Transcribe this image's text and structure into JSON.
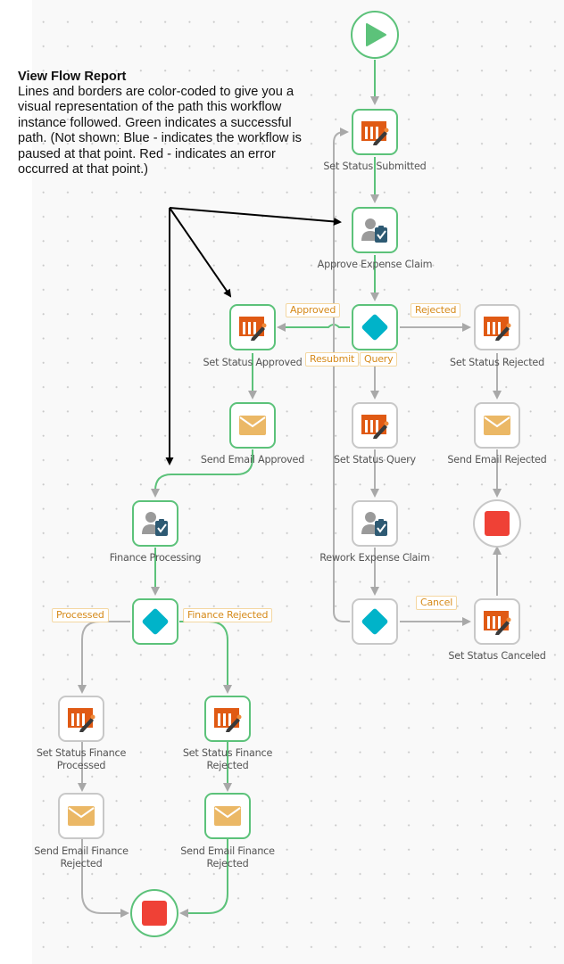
{
  "annotation": {
    "title": "View Flow Report",
    "body": "Lines and borders are color-coded to give you a visual representation of the path this workflow instance followed. Green indicates a successful path. (Not shown: Blue - indicates the workflow is paused at that point. Red - indicates an error occurred at that point.)"
  },
  "colors": {
    "success": "#5cc27a",
    "not_taken": "#c8c8c8",
    "decision": "#00b3c9",
    "stop": "#ef4136",
    "status_icon": "#e05a14",
    "email_icon": "#ebb866",
    "task_icon_badge": "#2e5a73",
    "branch_label": "#d68a1a"
  },
  "nodes": {
    "start": {
      "label": "",
      "type": "start",
      "status": "success"
    },
    "set_status_submitted": {
      "label": "Set Status Submitted",
      "type": "set-status",
      "status": "success"
    },
    "approve_expense_claim": {
      "label": "Approve Expense Claim",
      "type": "task",
      "status": "success"
    },
    "decision_approve": {
      "label": "",
      "type": "decision",
      "status": "success"
    },
    "set_status_approved": {
      "label": "Set Status Approved",
      "type": "set-status",
      "status": "success"
    },
    "send_email_approved": {
      "label": "Send Email Approved",
      "type": "email",
      "status": "success"
    },
    "set_status_rejected": {
      "label": "Set Status Rejected",
      "type": "set-status",
      "status": "not-taken"
    },
    "send_email_rejected": {
      "label": "Send Email Rejected",
      "type": "email",
      "status": "not-taken"
    },
    "stop_rejected": {
      "label": "",
      "type": "stop",
      "status": "not-taken"
    },
    "set_status_query": {
      "label": "Set Status Query",
      "type": "set-status",
      "status": "not-taken"
    },
    "rework_expense_claim": {
      "label": "Rework Expense Claim",
      "type": "task",
      "status": "not-taken"
    },
    "decision_rework": {
      "label": "",
      "type": "decision",
      "status": "not-taken"
    },
    "set_status_canceled": {
      "label": "Set Status Canceled",
      "type": "set-status",
      "status": "not-taken"
    },
    "finance_processing": {
      "label": "Finance Processing",
      "type": "task",
      "status": "success"
    },
    "decision_finance": {
      "label": "",
      "type": "decision",
      "status": "success"
    },
    "set_status_finance_processed": {
      "label": "Set Status Finance Processed",
      "type": "set-status",
      "status": "not-taken"
    },
    "set_status_finance_rejected": {
      "label": "Set Status Finance Rejected",
      "type": "set-status",
      "status": "success"
    },
    "send_email_finance_rejected_left": {
      "label": "Send Email Finance Rejected",
      "type": "email",
      "status": "not-taken"
    },
    "send_email_finance_rejected_right": {
      "label": "Send Email Finance Rejected",
      "type": "email",
      "status": "success"
    },
    "stop_finance": {
      "label": "",
      "type": "stop",
      "status": "success"
    }
  },
  "branches": {
    "approved": "Approved",
    "rejected": "Rejected",
    "resubmit": "Resubmit",
    "query": "Query",
    "cancel": "Cancel",
    "processed": "Processed",
    "finance_rejected": "Finance Rejected"
  }
}
